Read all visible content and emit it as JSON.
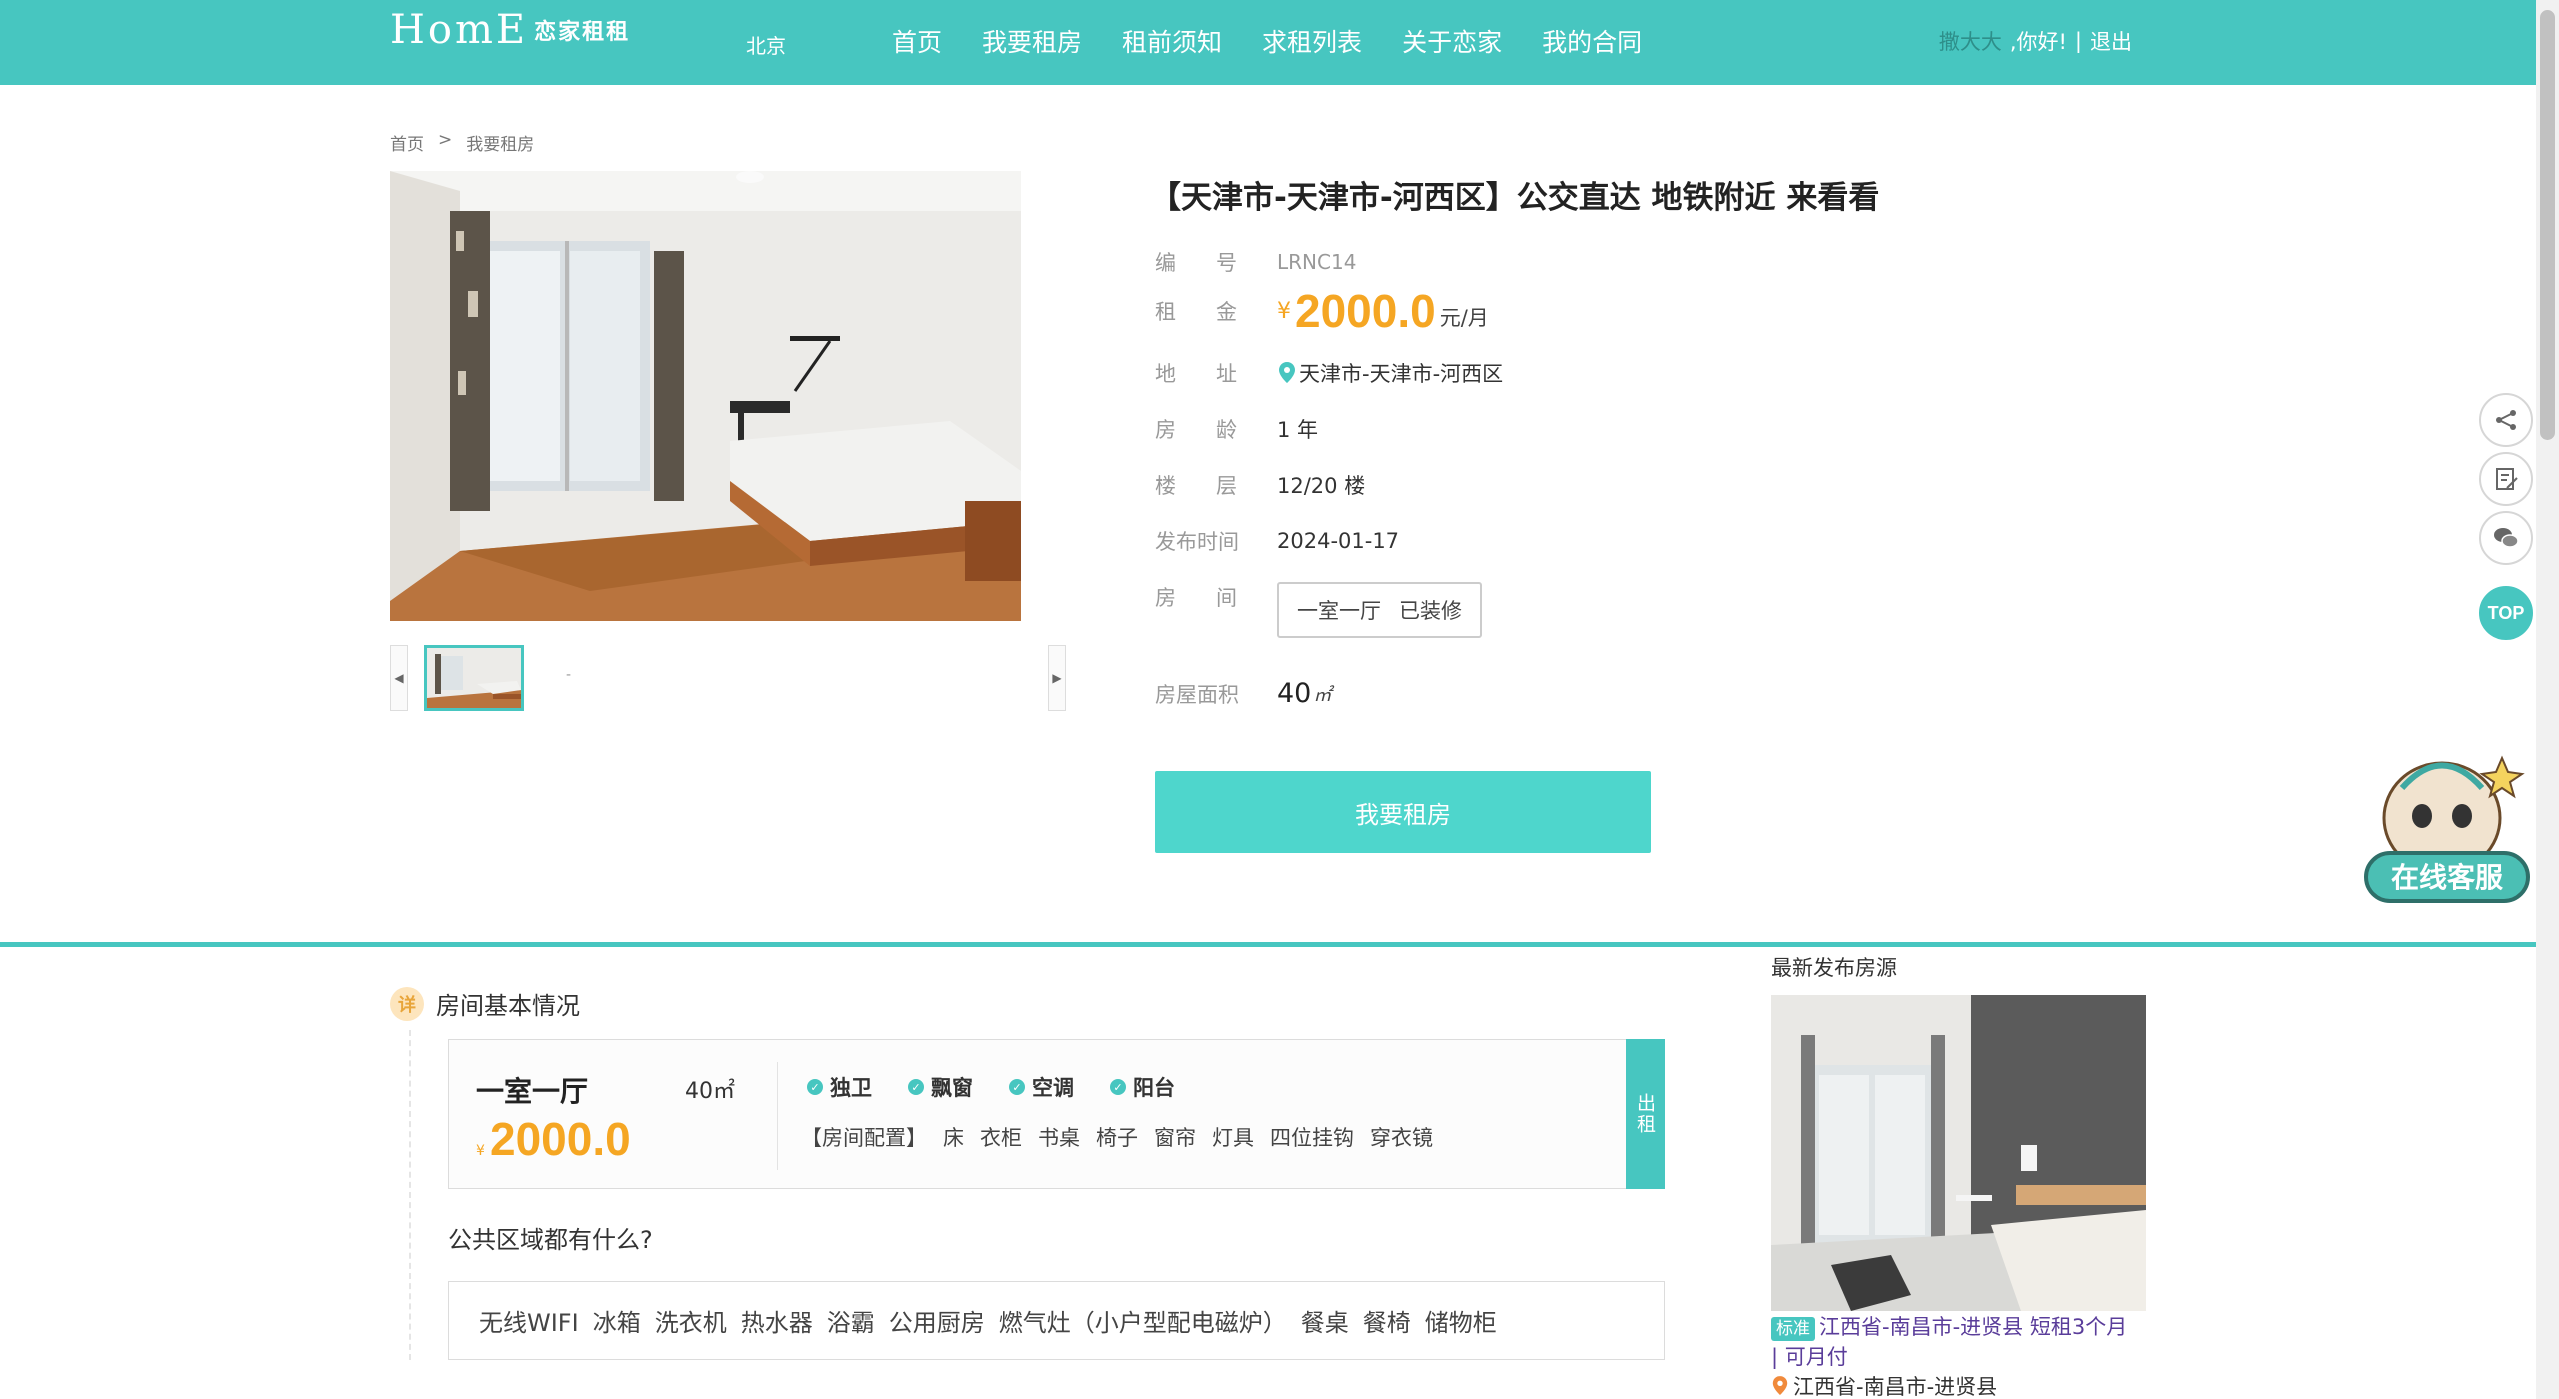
{
  "header": {
    "logo_text": "HomE",
    "logo_brand": "恋家租租",
    "city": "北京",
    "nav": [
      "首页",
      "我要租房",
      "租前须知",
      "求租列表",
      "关于恋家",
      "我的合同"
    ],
    "user_name": "撒大大",
    "greeting": ",你好!",
    "separator": "|",
    "logout": "退出"
  },
  "breadcrumb": {
    "home": "首页",
    "sep": ">",
    "current": "我要租房"
  },
  "listing": {
    "title": "【天津市-天津市-河西区】公交直达 地铁附近 来看看",
    "labels": {
      "code": [
        "编",
        "号"
      ],
      "rent": [
        "租",
        "金"
      ],
      "address": [
        "地",
        "址"
      ],
      "age": [
        "房",
        "龄"
      ],
      "floor": [
        "楼",
        "层"
      ],
      "published": "发布时间",
      "room": [
        "房",
        "间"
      ],
      "area": "房屋面积"
    },
    "code": "LRNC14",
    "price_symbol": "¥",
    "price": "2000.0",
    "price_unit": "元/月",
    "address": "天津市-天津市-河西区",
    "age": "1 年",
    "floor": "12/20 楼",
    "published": "2024-01-17",
    "room_type": "一室一厅",
    "decoration": "已装修",
    "area": "40",
    "area_unit": "㎡",
    "rent_button": "我要租房"
  },
  "gallery": {
    "prev": "◀",
    "next": "▶",
    "dash": "-"
  },
  "float": {
    "top_label": "TOP",
    "cs_label": "在线客服"
  },
  "basic": {
    "section_icon": "详",
    "section_title": "房间基本情况",
    "room_type": "一室一厅",
    "area": "40㎡",
    "price_symbol": "¥",
    "price": "2000.0",
    "features": [
      "独卫",
      "飘窗",
      "空调",
      "阳台"
    ],
    "config_label": "【房间配置】",
    "config": [
      "床",
      "衣柜",
      "书桌",
      "椅子",
      "窗帘",
      "灯具",
      "四位挂钩",
      "穿衣镜"
    ],
    "status": "出租",
    "public_question": "公共区域都有什么?",
    "public_items": [
      "无线WIFI",
      "冰箱",
      "洗衣机",
      "热水器",
      "浴霸",
      "公用厨房",
      "燃气灶（小户型配电磁炉）",
      "餐桌",
      "餐椅",
      "储物柜"
    ]
  },
  "latest": {
    "title": "最新发布房源",
    "tag": "标准",
    "headline": "江西省-南昌市-进贤县 短租3个月",
    "headline_sep": "|",
    "headline_tail": "可月付",
    "location": "江西省-南昌市-进贤县"
  },
  "colors": {
    "accent": "#47c6c0",
    "price": "#f5a623",
    "button": "#4ed6cc"
  }
}
